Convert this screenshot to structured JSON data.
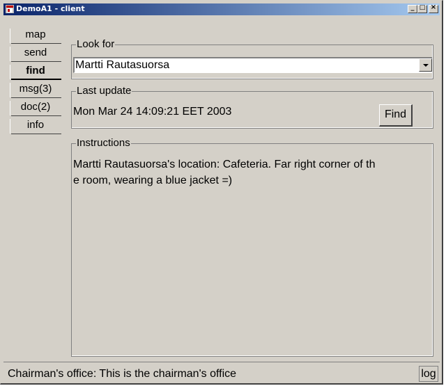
{
  "window": {
    "title": "DemoA1 - client",
    "minimize_glyph": "_",
    "maximize_glyph": "□",
    "close_glyph": "×"
  },
  "tabs": [
    {
      "label": "map",
      "active": false
    },
    {
      "label": "send",
      "active": false
    },
    {
      "label": "find",
      "active": true
    },
    {
      "label": "msg(3)",
      "active": false
    },
    {
      "label": "doc(2)",
      "active": false
    },
    {
      "label": "info",
      "active": false
    }
  ],
  "look_for": {
    "legend": "Look for",
    "selected": "Martti Rautasuorsa"
  },
  "last_update": {
    "legend": "Last update",
    "timestamp": "Mon Mar 24 14:09:21 EET 2003",
    "find_label": "Find"
  },
  "instructions": {
    "legend": "Instructions",
    "line1": "Martti Rautasuorsa's location: Cafeteria. Far right corner of th",
    "line2": "e room, wearing a blue jacket =)"
  },
  "status": {
    "text": "Chairman's office: This is the chairman's office",
    "log_label": "log"
  },
  "colors": {
    "title_start": "#0a246a",
    "title_end": "#a6caf0",
    "face": "#d4d0c8"
  }
}
